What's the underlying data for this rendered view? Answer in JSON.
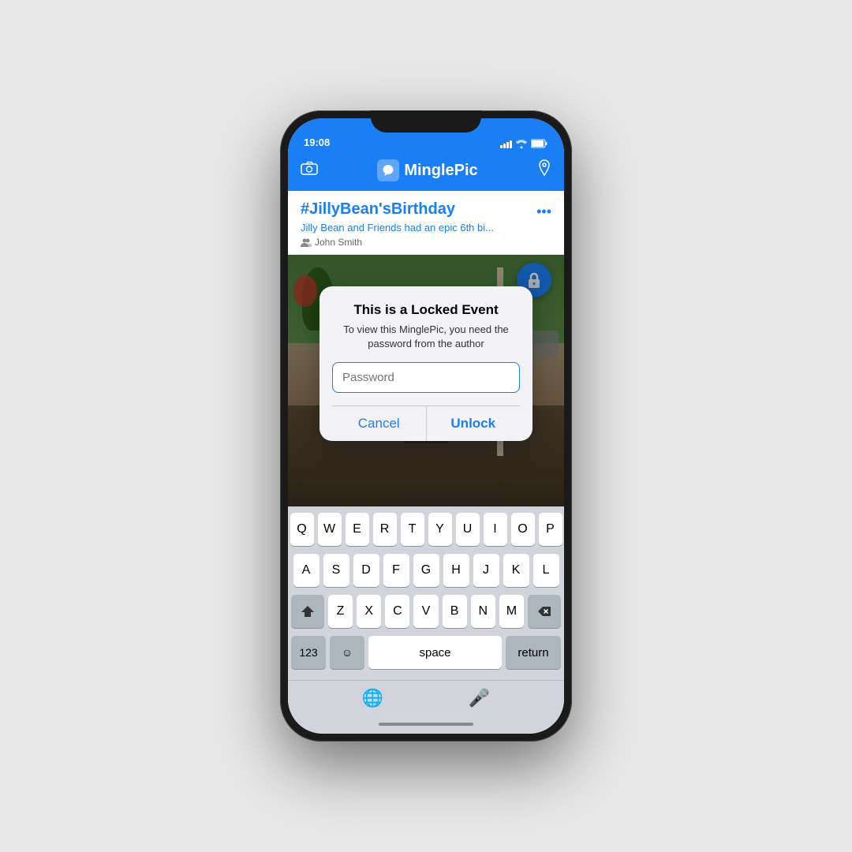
{
  "phone": {
    "status_bar": {
      "time": "19:08",
      "signal_icon": "signal",
      "wifi_icon": "wifi",
      "battery_icon": "battery"
    },
    "header": {
      "camera_icon": "camera",
      "app_name": "MinglePic",
      "location_icon": "location"
    },
    "event": {
      "title": "#JillyBean'sBirthday",
      "subtitle": "Jilly Bean and Friends had an epic 6th bi...",
      "author": "John Smith",
      "menu_icon": "ellipsis"
    },
    "modal": {
      "title": "This is a Locked Event",
      "description": "To view this MinglePic, you need the password from the author",
      "input_placeholder": "Password",
      "cancel_label": "Cancel",
      "unlock_label": "Unlock"
    },
    "lock_icon": "lock",
    "keyboard": {
      "row1": [
        "Q",
        "W",
        "E",
        "R",
        "T",
        "Y",
        "U",
        "I",
        "O",
        "P"
      ],
      "row2": [
        "A",
        "S",
        "D",
        "F",
        "G",
        "H",
        "J",
        "K",
        "L"
      ],
      "row3": [
        "Z",
        "X",
        "C",
        "V",
        "B",
        "N",
        "M"
      ],
      "numbers_label": "123",
      "emoji_icon": "emoji",
      "space_label": "space",
      "return_label": "return",
      "globe_icon": "globe",
      "mic_icon": "microphone"
    }
  }
}
